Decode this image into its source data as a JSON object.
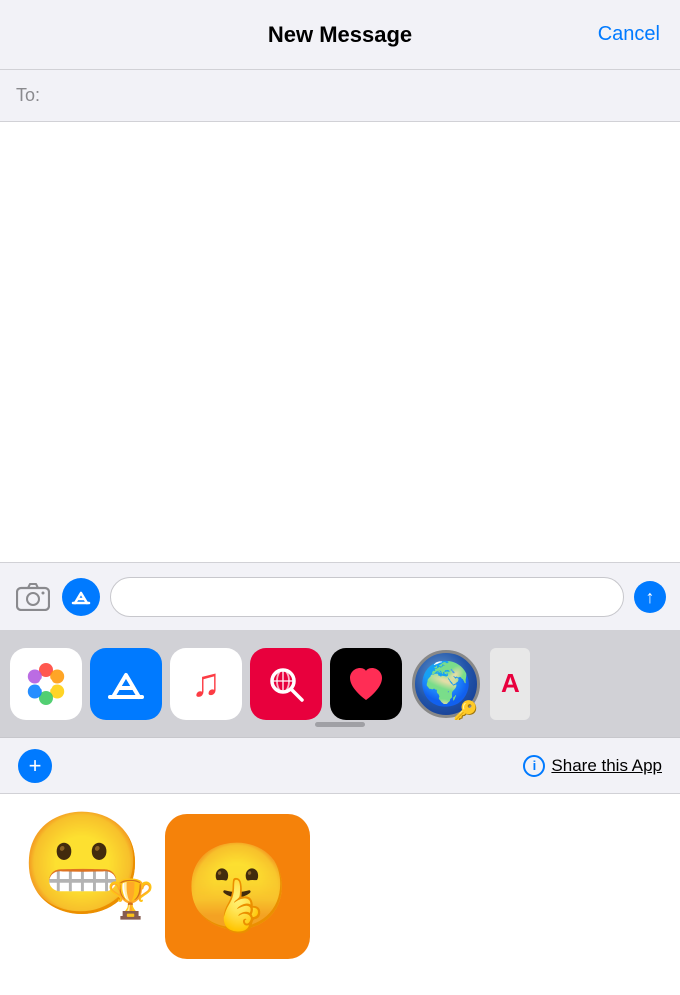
{
  "header": {
    "title": "New Message",
    "cancel_label": "Cancel"
  },
  "to_field": {
    "label": "To:",
    "placeholder": ""
  },
  "input_bar": {
    "placeholder": ""
  },
  "app_tray": {
    "apps": [
      {
        "id": "photos",
        "label": "Photos"
      },
      {
        "id": "appstore",
        "label": "App Store"
      },
      {
        "id": "music",
        "label": "Music"
      },
      {
        "id": "search",
        "label": "Search"
      },
      {
        "id": "heartblack",
        "label": "Heart App"
      },
      {
        "id": "globe",
        "label": "Globe"
      },
      {
        "id": "ad",
        "label": "AD"
      }
    ]
  },
  "action_bar": {
    "plus_label": "+",
    "info_label": "i",
    "share_label": "Share this App"
  },
  "send_arrow": "↑"
}
